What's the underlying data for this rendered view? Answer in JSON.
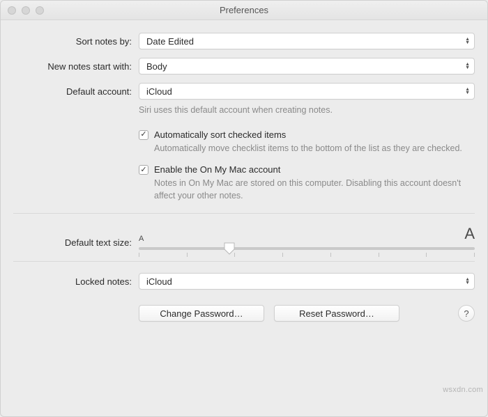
{
  "window": {
    "title": "Preferences"
  },
  "labels": {
    "sort_notes_by": "Sort notes by:",
    "new_notes_start_with": "New notes start with:",
    "default_account": "Default account:",
    "default_text_size": "Default text size:",
    "locked_notes": "Locked notes:"
  },
  "selects": {
    "sort_notes_by": "Date Edited",
    "new_notes_start_with": "Body",
    "default_account": "iCloud",
    "locked_notes": "iCloud"
  },
  "hints": {
    "default_account": "Siri uses this default account when creating notes.",
    "auto_sort": "Automatically move checklist items to the bottom of the list as they are checked.",
    "on_my_mac": "Notes in On My Mac are stored on this computer. Disabling this account doesn't affect your other notes."
  },
  "checkboxes": {
    "auto_sort_label": "Automatically sort checked items",
    "auto_sort_checked": true,
    "on_my_mac_label": "Enable the On My Mac account",
    "on_my_mac_checked": true
  },
  "slider": {
    "small_marker": "A",
    "large_marker": "A",
    "value_percent": 27,
    "ticks": 8
  },
  "buttons": {
    "change_password": "Change Password…",
    "reset_password": "Reset Password…",
    "help": "?"
  },
  "watermark": "wsxdn.com"
}
